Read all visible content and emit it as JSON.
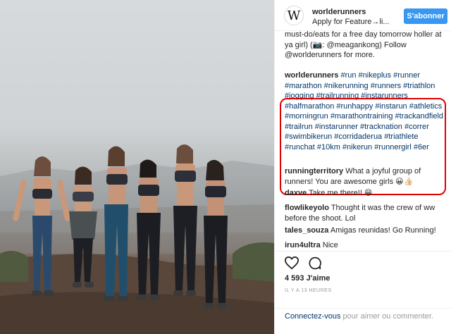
{
  "post": {
    "username": "worlderunners",
    "avatar_letter": "W",
    "location": "Apply for Feature→li...",
    "follow_label": "S'abonner"
  },
  "comments": {
    "top_cut": "must-do/eats for a free day tomorrow holler at ya girl) (📷: @meagankong) Follow @worlderunners for more.",
    "caption_user": "worlderunners",
    "caption_tags": "#run #nikeplus #runner #marathon #nikerunning #runners #triathlon #jogging #trailrunning #instarunners #halfmarathon #runhappy #instarun #athletics #morningrun #marathontraining #trackandfield #trailrun #instarunner #tracknation #correr #swimbikerun #corridaderua #triathlete #runchat #10km #nikerun #runnergirl #6er",
    "list": [
      {
        "user": "runningterritory",
        "text": "What a joyful group of runners! You are awesome girls 😀👍🏻"
      },
      {
        "user": "daxve",
        "text": "Take me there!! 😁"
      },
      {
        "user": "flowlikeyolo",
        "text": "Thought it was the crew of ww before the shoot. Lol"
      },
      {
        "user": "tales_souza",
        "text": "Amigas reunidas! Go Running!"
      },
      {
        "user": "irun4ultra",
        "text": "Nice"
      }
    ]
  },
  "actions": {
    "like_icon": "heart-icon",
    "comment_icon": "comment-icon",
    "likes": "4 593 J'aime",
    "time": "IL Y A 13 HEURES"
  },
  "login": {
    "link": "Connectez-vous",
    "rest": " pour aimer ou commenter."
  },
  "colors": {
    "follow_button": "#3897f0",
    "highlight_box": "#e00000",
    "link": "#003569"
  }
}
